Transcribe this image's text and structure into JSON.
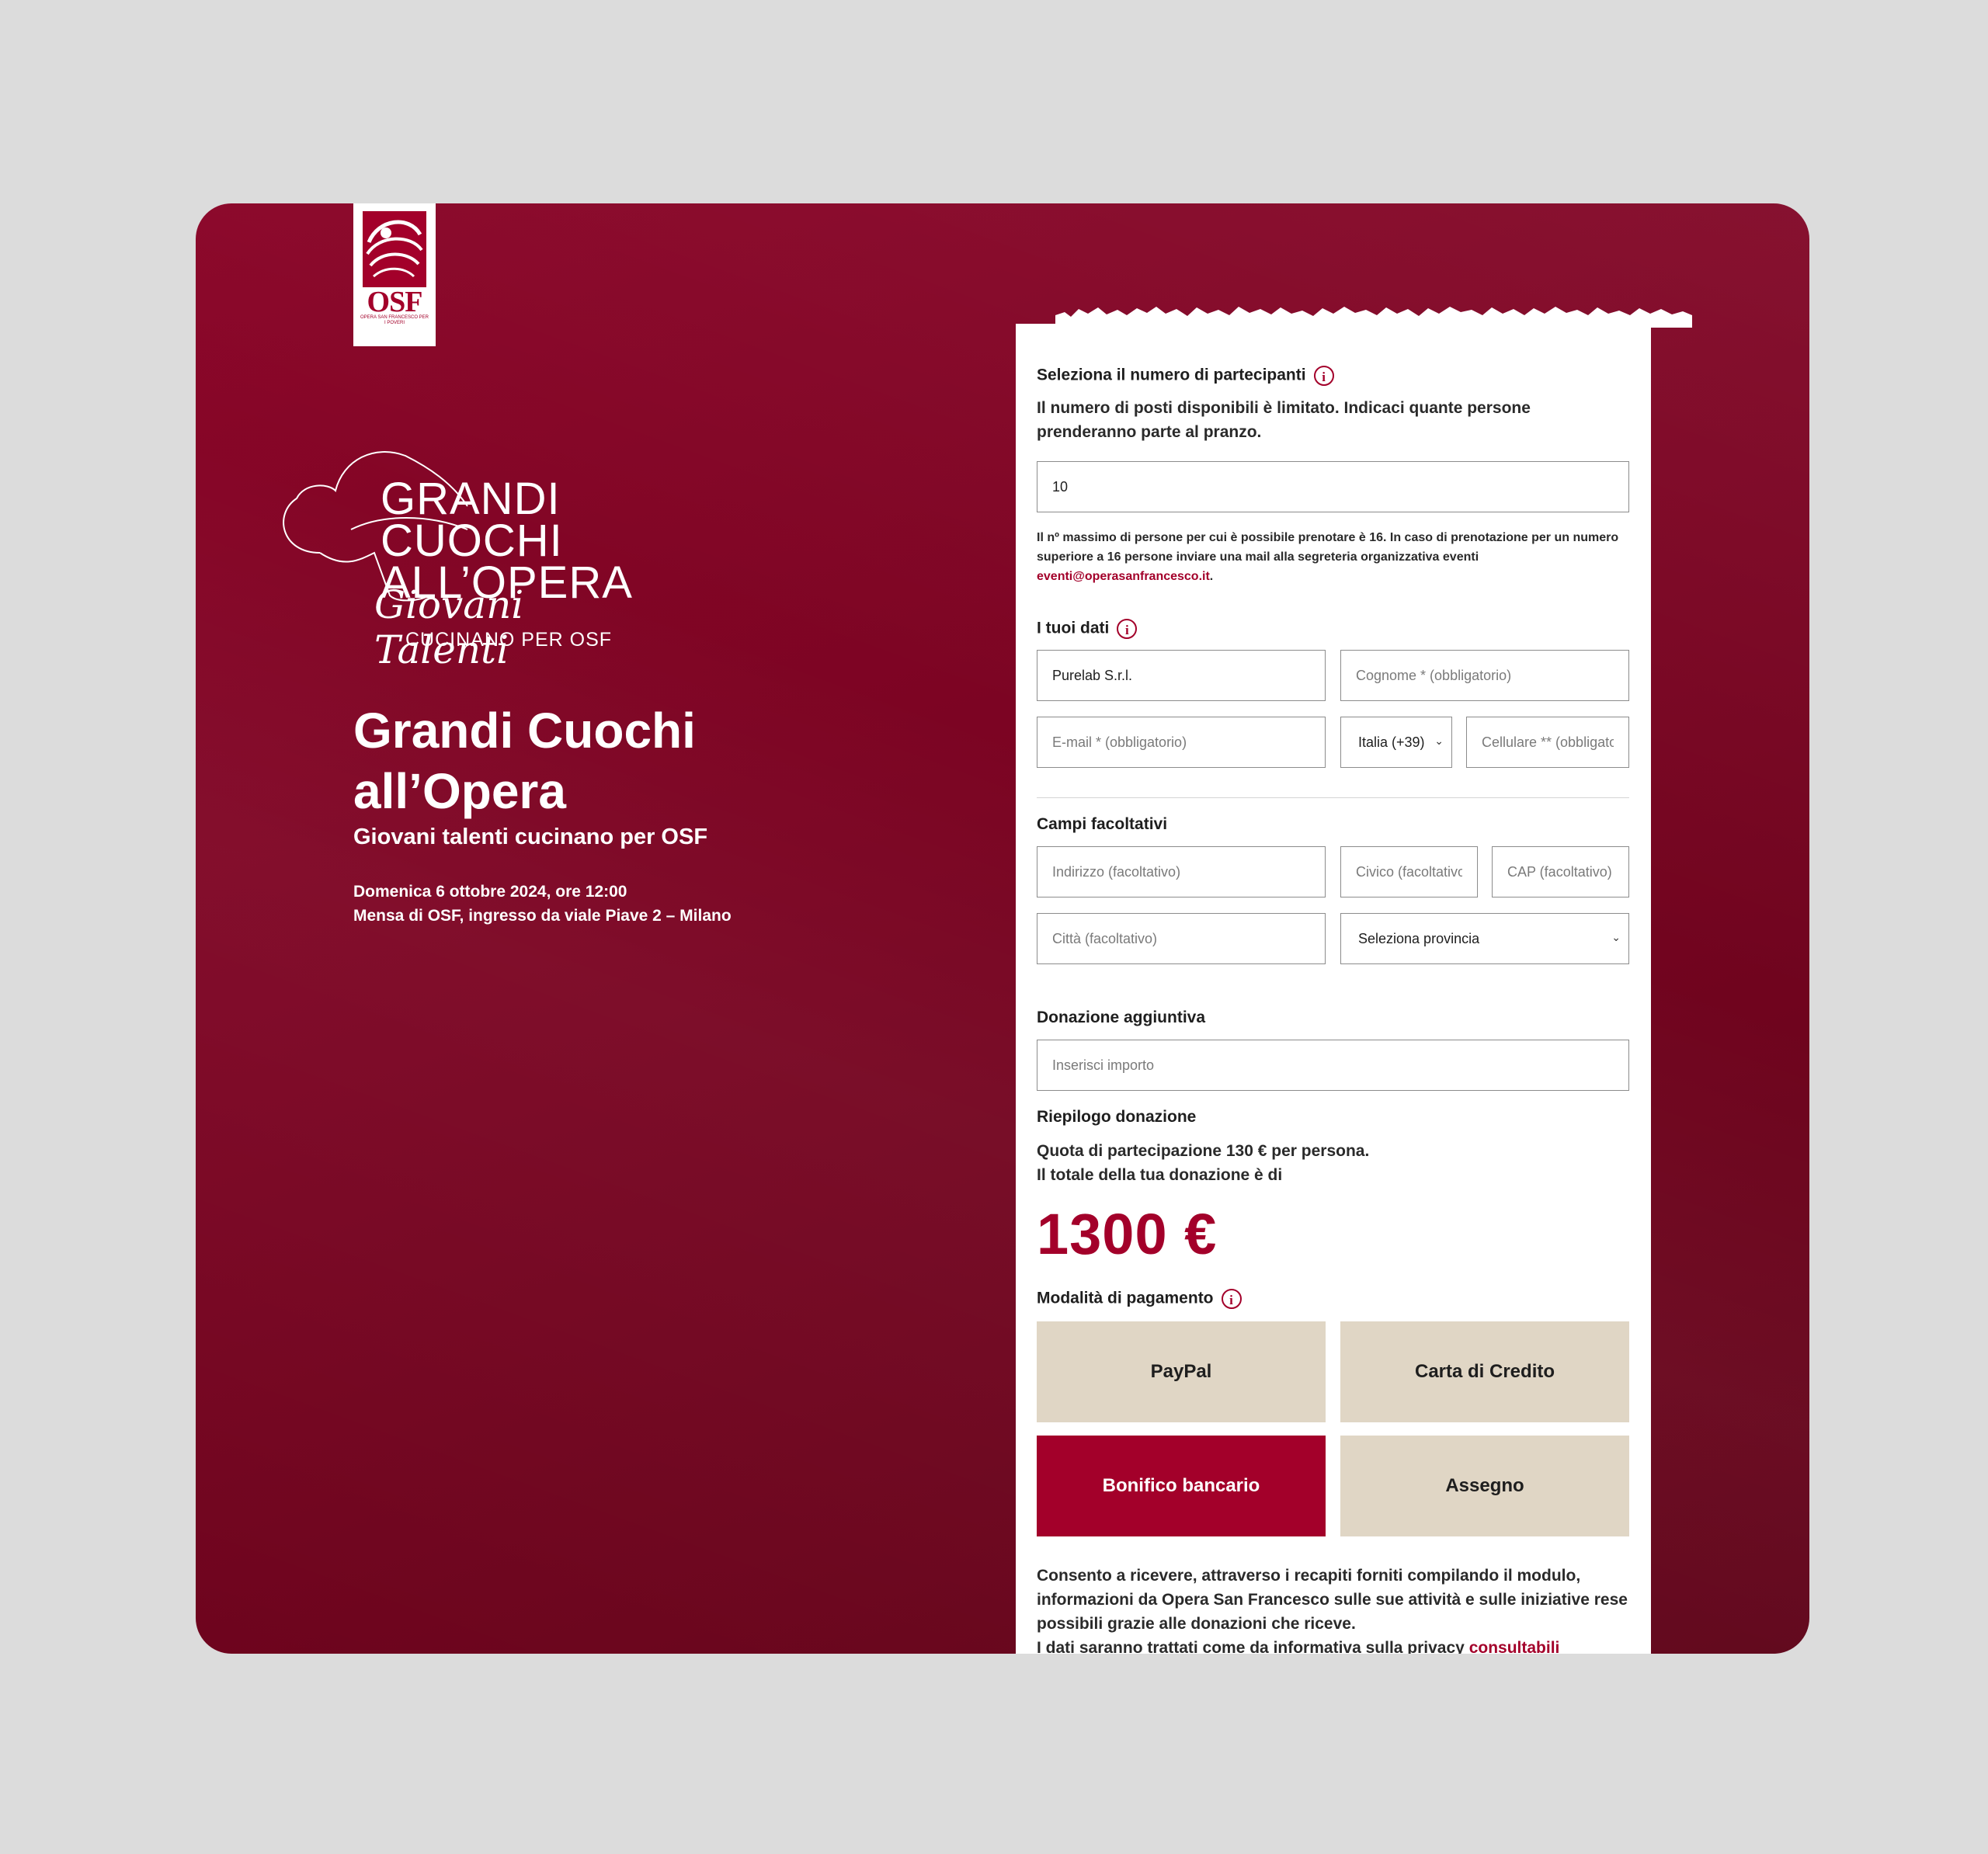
{
  "brand": {
    "logo_text": "OSF",
    "logo_subtext": "OPERA SAN FRANCESCO PER I POVERI"
  },
  "event_logo": {
    "line1": "GRANDI",
    "line2": "CUOCHI",
    "line3": "ALL’OPERA",
    "script": "Giovani Talenti",
    "sub": "CUCINANO PER OSF"
  },
  "hero": {
    "title": "Grandi Cuochi all’Opera",
    "subtitle": "Giovani talenti cucinano per OSF",
    "date": "Domenica 6 ottobre 2024, ore 12:00",
    "location": "Mensa di OSF, ingresso da viale Piave 2 – Milano"
  },
  "form": {
    "participants": {
      "label": "Seleziona il numero di partecipanti",
      "description": "Il numero di posti disponibili è limitato. Indicaci quante persone prenderanno parte al pranzo.",
      "value": "10",
      "note": "Il nº massimo di persone per cui è possibile prenotare è 16. In caso di prenotazione per un numero superiore a 16 persone inviare una mail alla segreteria organizzativa eventi",
      "note_email": "eventi@operasanfrancesco.it",
      "note_end": "."
    },
    "personal": {
      "label": "I tuoi dati",
      "name_value": "Purelab S.r.l.",
      "surname_placeholder": "Cognome * (obbligatorio)",
      "email_placeholder": "E-mail * (obbligatorio)",
      "country_code": "Italia (+39)",
      "phone_placeholder": "Cellulare ** (obbligatorio)"
    },
    "optional": {
      "label": "Campi facoltativi",
      "address_placeholder": "Indirizzo (facoltativo)",
      "civic_placeholder": "Civico (facoltativo)",
      "cap_placeholder": "CAP (facoltativo)",
      "city_placeholder": "Città (facoltativo)",
      "province": "Seleziona provincia"
    },
    "donation": {
      "label": "Donazione aggiuntiva",
      "amount_placeholder": "Inserisci importo"
    },
    "summary": {
      "label": "Riepilogo donazione",
      "line1": "Quota di partecipazione 130 € per persona.",
      "line2": "Il totale della tua donazione è di",
      "total": "1300 €"
    },
    "payment": {
      "label": "Modalità di pagamento",
      "methods": [
        "PayPal",
        "Carta di Credito",
        "Bonifico bancario",
        "Assegno"
      ],
      "selected": "Bonifico bancario"
    },
    "consent": {
      "text": "Consento a ricevere, attraverso i recapiti forniti compilando il modulo, informazioni da Opera San Francesco sulle sue attività e sulle iniziative rese possibili grazie alle donazioni che riceve.",
      "privacy_text": "I dati saranno trattati come da informativa sulla privacy",
      "privacy_link": "consultabili"
    }
  },
  "colors": {
    "background": "#dcdcdc",
    "brand_red": "#a3002a",
    "panel_red": "#7a0422",
    "payment_beige": "#e0d6c5"
  }
}
